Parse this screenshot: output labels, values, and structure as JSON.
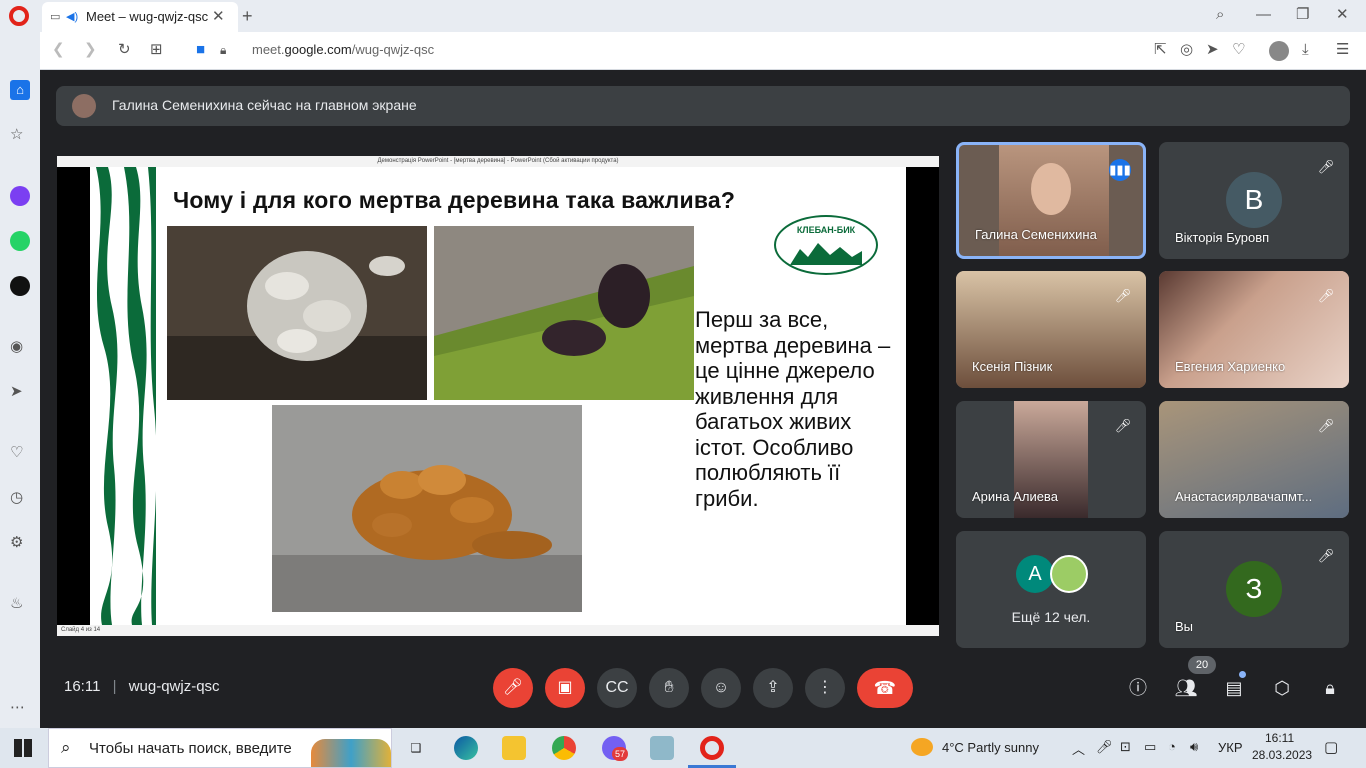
{
  "browser": {
    "tab_title": "Meet – wug-qwjz-qsc",
    "url_prefix": "meet.",
    "url_domain": "google.com",
    "url_path": "/wug-qwjz-qsc"
  },
  "meet": {
    "banner_text": "Галина Семенихина сейчас на главном экране",
    "presentation": {
      "window_title": "Демонстрація PowerPoint - [мертва деревина] - PowerPoint (Сбой активации продукта)",
      "status_text": "Слайд 4 из 14",
      "heading": "Чому і для кого мертва деревина така важлива?",
      "body": "Перш за все, мертва деревина – це цінне джерело живлення для багатьох живих істот. Особливо полюбляють її гриби.",
      "logo_text": "КЛЕБАН-БИК"
    },
    "tiles": [
      {
        "name": "Галина Семенихина",
        "speaking": true
      },
      {
        "name": "Вікторія Буровп",
        "initial": "В",
        "avatar_color": "#455a64"
      },
      {
        "name": "Ксенія Пізник"
      },
      {
        "name": "Евгения Хариенко"
      },
      {
        "name": "Арина Алиева"
      },
      {
        "name": "Анастасияpлвачапмт..."
      },
      {
        "name": "Ещё 12 чел.",
        "initial": "А",
        "avatar_color": "#00897b"
      },
      {
        "name": "Вы",
        "initial": "З",
        "avatar_color": "#33691e"
      }
    ],
    "time": "16:11",
    "meeting_code": "wug-qwjz-qsc",
    "participants_count": "20"
  },
  "taskbar": {
    "search_placeholder": "Чтобы начать поиск, введите",
    "weather": "4°C  Partly sunny",
    "lang": "УКР",
    "clock_time": "16:11",
    "clock_date": "28.03.2023",
    "viber_badge": "57"
  },
  "colors": {
    "meet_bg": "#202124",
    "tile_bg": "#3c4043",
    "danger": "#ea4335",
    "speaking_border": "#8ab4f8"
  }
}
